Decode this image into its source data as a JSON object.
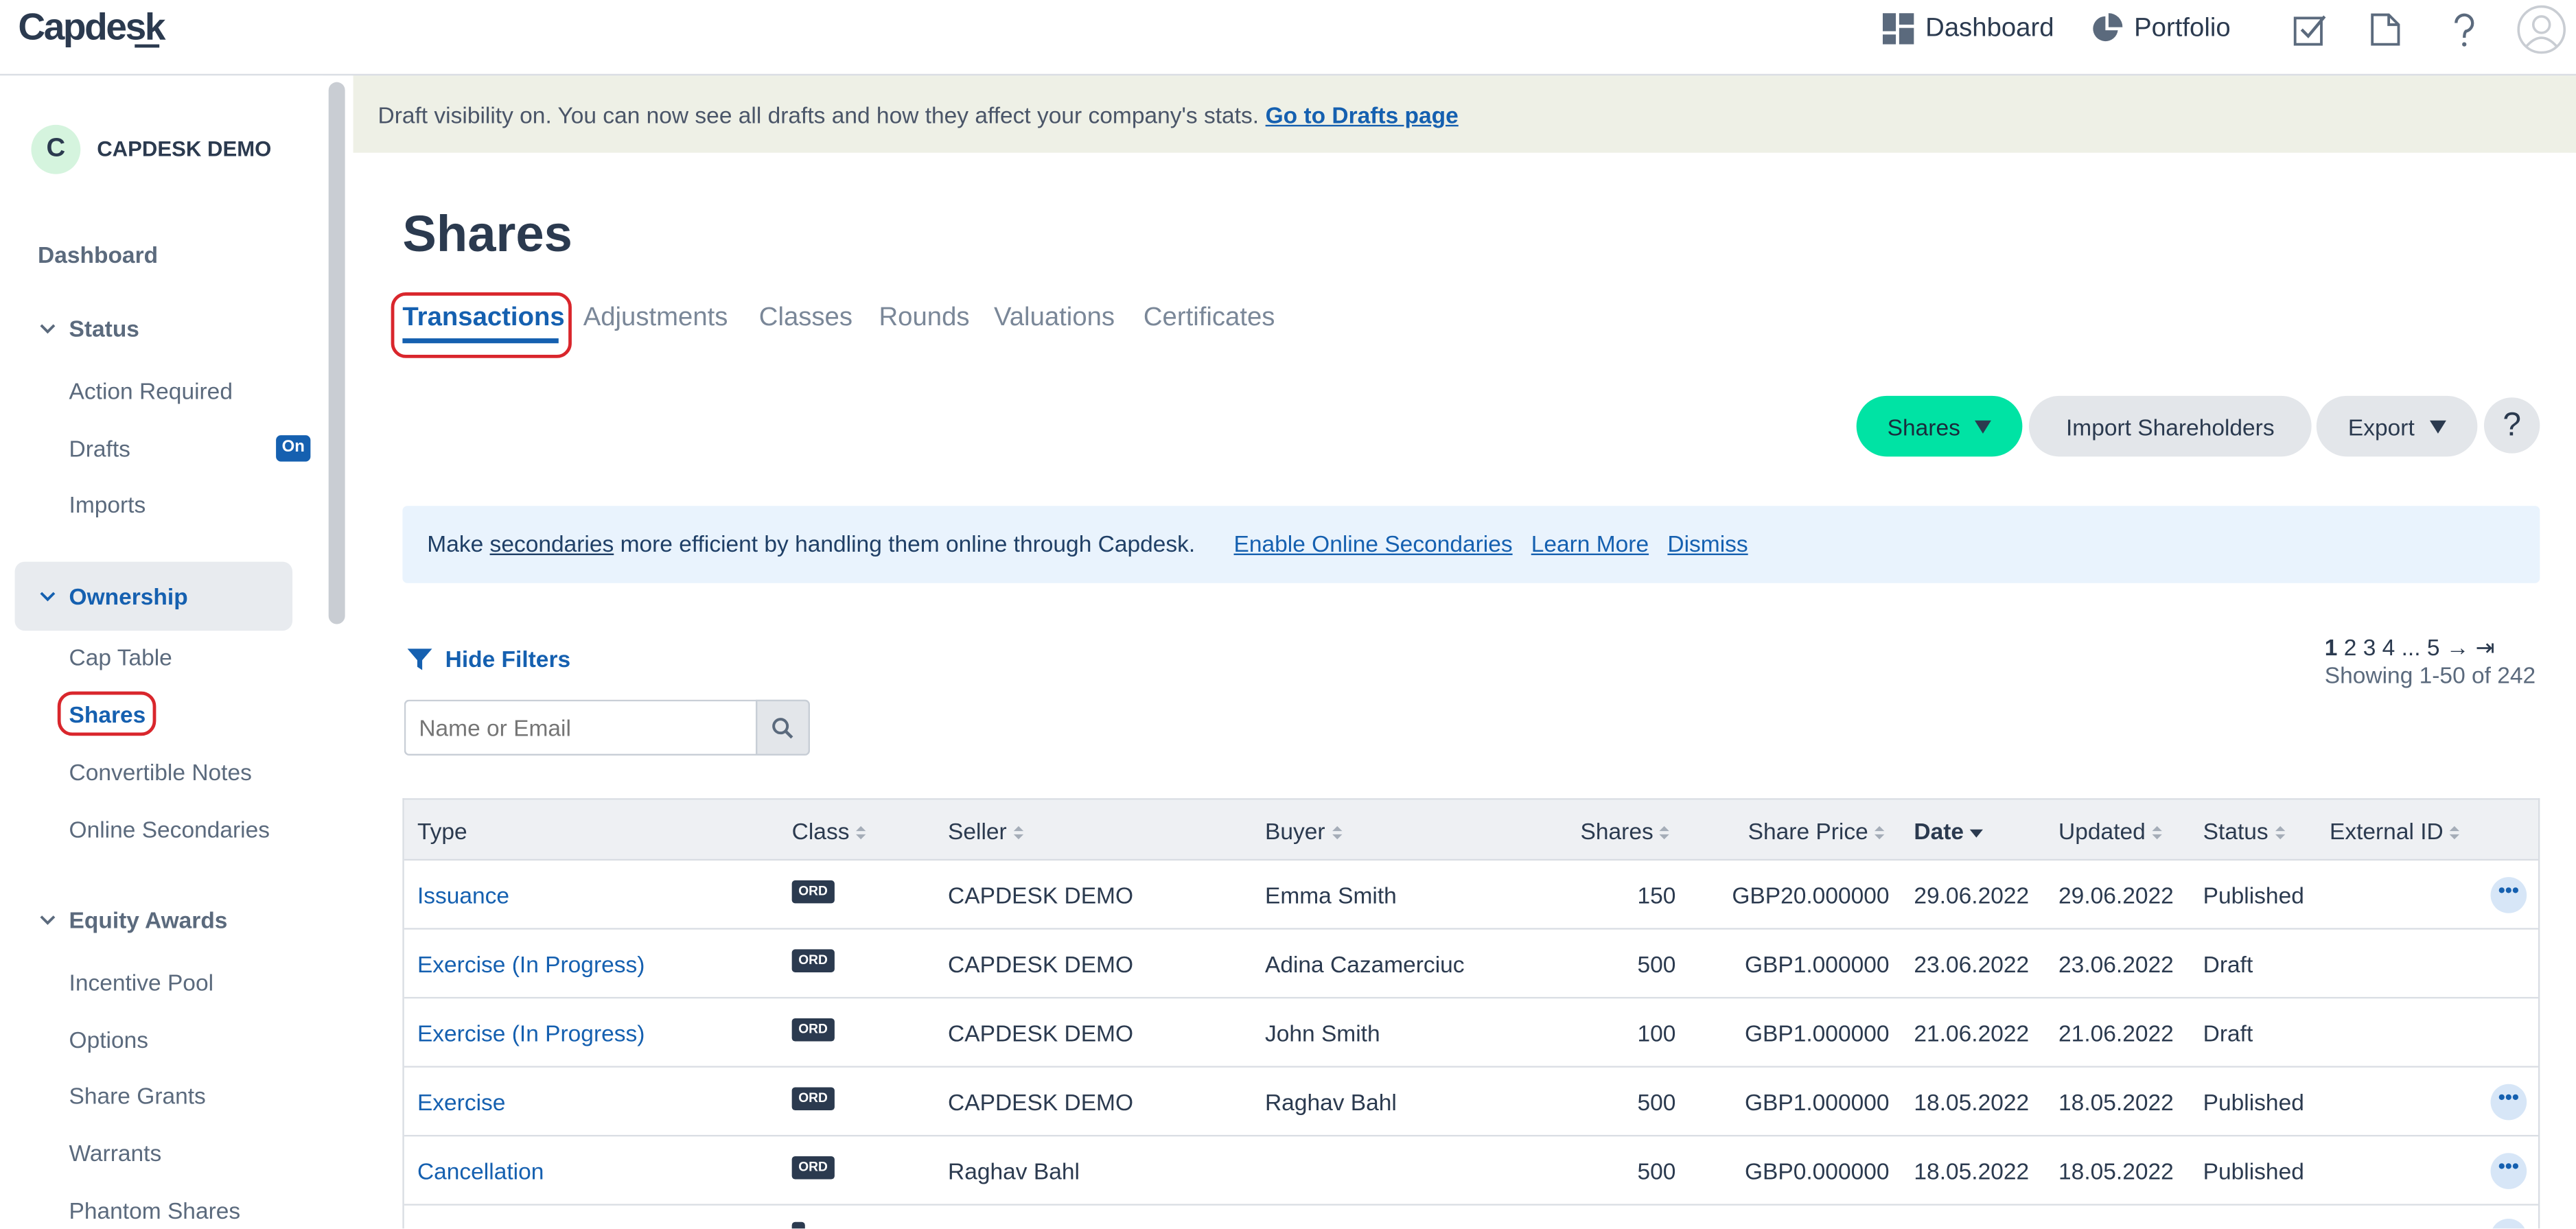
{
  "app": {
    "logo": "Capdesk"
  },
  "topnav": {
    "dashboard": "Dashboard",
    "portfolio": "Portfolio"
  },
  "sidebar": {
    "company_logo_letter": "C",
    "company_name": "CAPDESK DEMO",
    "dashboard": "Dashboard",
    "status": {
      "label": "Status",
      "items": [
        "Action Required",
        "Drafts",
        "Imports"
      ],
      "drafts_badge": "On"
    },
    "ownership": {
      "label": "Ownership",
      "items": [
        "Cap Table",
        "Shares",
        "Convertible Notes",
        "Online Secondaries"
      ]
    },
    "equity_awards": {
      "label": "Equity Awards",
      "items": [
        "Incentive Pool",
        "Options",
        "Share Grants",
        "Warrants",
        "Phantom Shares"
      ]
    }
  },
  "banner": {
    "text": "Draft visibility on. You can now see all drafts and how they affect your company's stats.",
    "link": "Go to Drafts page"
  },
  "page": {
    "title": "Shares"
  },
  "tabs": [
    "Transactions",
    "Adjustments",
    "Classes",
    "Rounds",
    "Valuations",
    "Certificates"
  ],
  "actions": {
    "shares": "Shares",
    "import": "Import Shareholders",
    "export": "Export",
    "help": "?"
  },
  "info": {
    "pre": "Make",
    "underlined": "secondaries",
    "post": "more efficient by handling them online through Capdesk.",
    "enable": "Enable Online Secondaries",
    "learn": "Learn More",
    "dismiss": "Dismiss"
  },
  "filters": {
    "toggle": "Hide Filters",
    "search_placeholder": "Name or Email"
  },
  "pagination": {
    "current": "1",
    "pages": "2 3 4 ... 5 → ⇥",
    "showing": "Showing 1-50 of 242"
  },
  "table": {
    "headers": [
      "Type",
      "Class",
      "Seller",
      "Buyer",
      "Shares",
      "Share Price",
      "Date",
      "Updated",
      "Status",
      "External ID"
    ],
    "rows": [
      {
        "type": "Issuance",
        "class": "ORD",
        "seller": "CAPDESK DEMO",
        "buyer": "Emma Smith",
        "shares": "150",
        "price": "GBP20.000000",
        "date": "29.06.2022",
        "updated": "29.06.2022",
        "status": "Published",
        "external_id": "",
        "menu": "•••"
      },
      {
        "type": "Exercise (In Progress)",
        "class": "ORD",
        "seller": "CAPDESK DEMO",
        "buyer": "Adina Cazamerciuc",
        "shares": "500",
        "price": "GBP1.000000",
        "date": "23.06.2022",
        "updated": "23.06.2022",
        "status": "Draft",
        "external_id": "",
        "menu": ""
      },
      {
        "type": "Exercise (In Progress)",
        "class": "ORD",
        "seller": "CAPDESK DEMO",
        "buyer": "John Smith",
        "shares": "100",
        "price": "GBP1.000000",
        "date": "21.06.2022",
        "updated": "21.06.2022",
        "status": "Draft",
        "external_id": "",
        "menu": ""
      },
      {
        "type": "Exercise",
        "class": "ORD",
        "seller": "CAPDESK DEMO",
        "buyer": "Raghav Bahl",
        "shares": "500",
        "price": "GBP1.000000",
        "date": "18.05.2022",
        "updated": "18.05.2022",
        "status": "Published",
        "external_id": "",
        "menu": "•••"
      },
      {
        "type": "Cancellation",
        "class": "ORD",
        "seller": "Raghav Bahl",
        "buyer": "",
        "shares": "500",
        "price": "GBP0.000000",
        "date": "18.05.2022",
        "updated": "18.05.2022",
        "status": "Published",
        "external_id": "",
        "menu": "•••"
      }
    ]
  },
  "colors": {
    "brand_blue": "#1560b0",
    "accent_green": "#00e3a4",
    "highlight_red": "#d9262c",
    "text_dark": "#2b3a4f"
  }
}
